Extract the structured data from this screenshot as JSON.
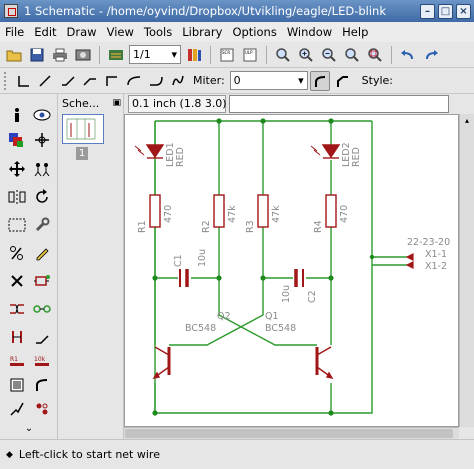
{
  "window": {
    "title": "1 Schematic - /home/oyvind/Dropbox/Utvikling/eagle/LED-blink"
  },
  "menu": {
    "items": [
      "File",
      "Edit",
      "Draw",
      "View",
      "Tools",
      "Library",
      "Options",
      "Window",
      "Help"
    ]
  },
  "toolbar": {
    "sheet_value": "1/1"
  },
  "wire_toolbar": {
    "miter_label": "Miter:",
    "miter_value": "0",
    "style_label": "Style:"
  },
  "sheets_panel": {
    "title": "Sche...",
    "sheet_number": "1"
  },
  "coords": {
    "value": "0.1 inch (1.8 3.0)"
  },
  "command": {
    "value": ""
  },
  "status": {
    "text": "Left-click to start net wire"
  },
  "schematic": {
    "led1": {
      "name": "LED1",
      "value": "RED"
    },
    "led2": {
      "name": "LED2",
      "value": "RED"
    },
    "r1": {
      "name": "R1",
      "value": "470"
    },
    "r2": {
      "name": "R2",
      "value": "47k"
    },
    "r3": {
      "name": "R3",
      "value": "47k"
    },
    "r4": {
      "name": "R4",
      "value": "470"
    },
    "c1": {
      "name": "C1",
      "value": "10u"
    },
    "c2": {
      "name": "C2",
      "value": "10u"
    },
    "q1": {
      "name": "Q1",
      "value": "BC548"
    },
    "q2": {
      "name": "Q2",
      "value": "BC548"
    },
    "connector": {
      "part": "22-23-20",
      "pin1": "X1-1",
      "pin2": "X1-2"
    }
  },
  "colors": {
    "net": "#2c9a2c",
    "junction": "#1e8a1e",
    "part_body": "#a11616",
    "part_text": "#8a8a8a",
    "accent": "#4a78b5"
  }
}
